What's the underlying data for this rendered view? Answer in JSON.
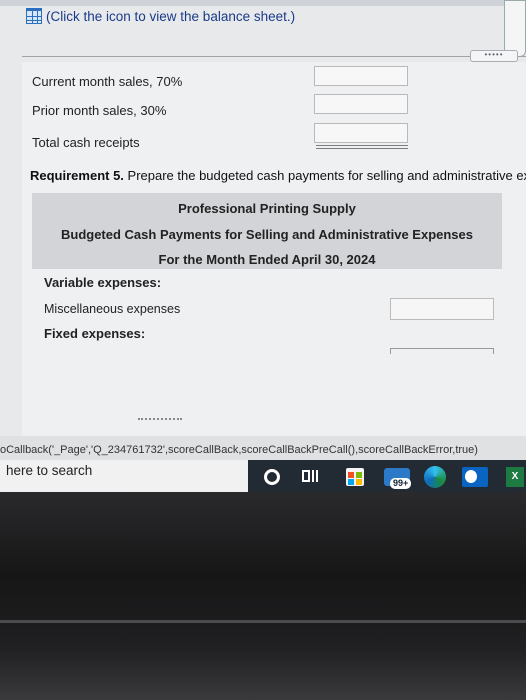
{
  "balance_sheet_link": "(Click the icon to view the balance sheet.)",
  "cash_receipts": {
    "rows": [
      {
        "label": "Current month sales, 70%"
      },
      {
        "label": "Prior month sales, 30%"
      },
      {
        "label": "Total cash receipts"
      }
    ]
  },
  "requirement": {
    "prefix": "Requirement 5.",
    "text": " Prepare the budgeted cash payments for selling and administrative exp"
  },
  "schedule": {
    "company": "Professional Printing Supply",
    "title": "Budgeted Cash Payments for Selling and Administrative Expenses",
    "period": "For the Month Ended April 30, 2024",
    "variable_heading": "Variable expenses:",
    "misc_label": "Miscellaneous expenses",
    "fixed_heading": "Fixed expenses:"
  },
  "status_bar": "oCallback('_Page','Q_234761732',scoreCallBack,scoreCallBackPreCall(),scoreCallBackError,true)",
  "taskbar": {
    "search_placeholder": "here to search",
    "mail_badge": "99+",
    "excel_label": "X"
  },
  "icons": [
    "balance-sheet-grid-icon",
    "cortana-icon",
    "task-view-icon",
    "store-icon",
    "mail-icon",
    "edge-icon",
    "outlook-icon",
    "excel-icon"
  ],
  "colors": {
    "link": "#1a3a8a",
    "header_band": "#d2d4d7",
    "taskbar": "#222a33"
  }
}
